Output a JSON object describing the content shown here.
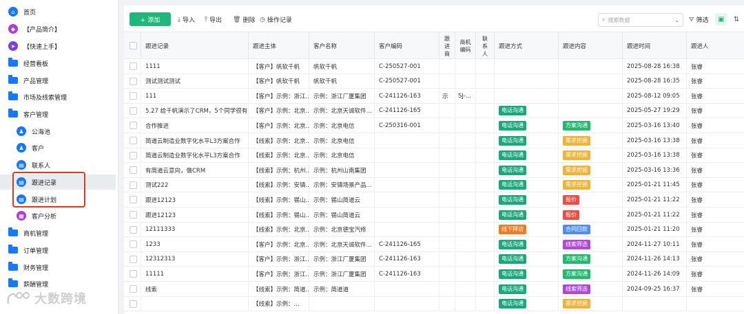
{
  "sidebar": {
    "items": [
      {
        "label": "首页",
        "icon": "home-icon",
        "color": "#1677ff"
      },
      {
        "label": "【产品简介】",
        "icon": "tag-icon",
        "color": "#b03cd6"
      },
      {
        "label": "【快速上手】",
        "icon": "send-icon",
        "color": "#7b3fe4"
      },
      {
        "label": "经营看板",
        "icon": "folder-icon"
      },
      {
        "label": "产品管理",
        "icon": "folder-icon"
      },
      {
        "label": "市场及线索管理",
        "icon": "folder-icon"
      },
      {
        "label": "客户管理",
        "icon": "folder-open-icon"
      },
      {
        "label": "公海池",
        "icon": "users-icon",
        "color": "#1677ff"
      },
      {
        "label": "客户",
        "icon": "user-icon",
        "color": "#1677ff"
      },
      {
        "label": "联系人",
        "icon": "contact-icon",
        "color": "#1677ff"
      },
      {
        "label": "跟进记录",
        "icon": "record-icon",
        "color": "#1677ff"
      },
      {
        "label": "跟进计划",
        "icon": "plan-icon",
        "color": "#1677ff"
      },
      {
        "label": "客户分析",
        "icon": "analysis-icon",
        "color": "#b03cd6"
      },
      {
        "label": "商机管理",
        "icon": "folder-icon"
      },
      {
        "label": "订单管理",
        "icon": "folder-icon"
      },
      {
        "label": "财务管理",
        "icon": "folder-icon"
      },
      {
        "label": "薪酬管理",
        "icon": "folder-icon"
      }
    ]
  },
  "watermark": "大数跨境",
  "toolbar": {
    "add_label": "+ 添加",
    "import_label": "导入",
    "export_label": "导出",
    "delete_label": "删除",
    "log_label": "操作记录",
    "search_placeholder": "搜索数据",
    "filter_label": "筛选"
  },
  "table": {
    "headers": [
      "跟进记录",
      "跟进主体",
      "客户名称",
      "客户编码",
      "跟进商",
      "商机编码",
      "联系人",
      "跟进方式",
      "跟进内容",
      "跟进时间",
      "跟进人"
    ],
    "rows": [
      {
        "record": "1111",
        "subject": "【客户】帆软千帆",
        "customer": "帆软千帆",
        "code": "C-250527-001",
        "biz": "",
        "bizcode": "",
        "contact": "",
        "method": "",
        "content": "",
        "time": "2025-08-28 16:38",
        "owner": "张睿"
      },
      {
        "record": "测试测试测试",
        "subject": "【客户】帆软千帆",
        "customer": "帆软千帆",
        "code": "C-250527-001",
        "biz": "",
        "bizcode": "",
        "contact": "",
        "method": "",
        "content": "",
        "time": "2025-08-28 16:35",
        "owner": "张睿"
      },
      {
        "record": "111",
        "subject": "【客户】示例：浙江...",
        "customer": "示例：浙江厂厦集团",
        "code": "C-241126-163",
        "biz": "示",
        "bizcode": "SJ-...",
        "contact": "",
        "method": "",
        "content": "",
        "time": "2025-08-12 09:05",
        "owner": "张睿"
      },
      {
        "record": "5.27 给千帆演示了CRM，5个同学很有...",
        "subject": "【客户】示例：北京...",
        "customer": "示例：北京天诚软件...",
        "code": "C-241126-165",
        "biz": "",
        "bizcode": "",
        "contact": "",
        "method": "电话沟通",
        "content": "",
        "time": "2025-05-27 19:29",
        "owner": "张睿"
      },
      {
        "record": "合作推进",
        "subject": "【客户】示例：北京...",
        "customer": "示例：北京电信",
        "code": "C-250316-001",
        "biz": "",
        "bizcode": "",
        "contact": "",
        "method": "电话沟通",
        "content": "方案沟通",
        "time": "2025-03-16 13:40",
        "owner": "张睿"
      },
      {
        "record": "简道云制造业数字化水平L3方案合作",
        "subject": "【线索】示例：北京...",
        "customer": "示例：北京电信",
        "code": "",
        "biz": "",
        "bizcode": "",
        "contact": "",
        "method": "电话沟通",
        "content": "需求挖掘",
        "time": "2025-03-16 13:38",
        "owner": "张睿"
      },
      {
        "record": "简道云制造业数字化水平L3方案合作",
        "subject": "【线索】示例：北京...",
        "customer": "示例：北京电信",
        "code": "",
        "biz": "",
        "bizcode": "",
        "contact": "",
        "method": "电话沟通",
        "content": "需求挖掘",
        "time": "2025-03-16 13:38",
        "owner": "张睿"
      },
      {
        "record": "有简道云意向，做CRM",
        "subject": "【线索】示例：杭州...",
        "customer": "示例：杭州山南集团",
        "code": "",
        "biz": "",
        "bizcode": "",
        "contact": "",
        "method": "电话沟通",
        "content": "需求挖掘",
        "time": "2025-03-16 13:36",
        "owner": "张睿"
      },
      {
        "record": "测试222",
        "subject": "【线索】示例：安镇...",
        "customer": "示例：安镇场景产品...",
        "code": "",
        "biz": "",
        "bizcode": "",
        "contact": "",
        "method": "电话沟通",
        "content": "需求挖掘",
        "time": "2025-01-21 11:45",
        "owner": "张睿"
      },
      {
        "record": "跟进12123",
        "subject": "【线索】示例：锡山...",
        "customer": "示例：锡山简道云",
        "code": "",
        "biz": "",
        "bizcode": "",
        "contact": "",
        "method": "电话沟通",
        "content": "报价",
        "time": "2025-01-21 11:22",
        "owner": "张睿"
      },
      {
        "record": "跟进12123",
        "subject": "【线索】示例：锡山...",
        "customer": "示例：锡山简道云",
        "code": "",
        "biz": "",
        "bizcode": "",
        "contact": "",
        "method": "电话沟通",
        "content": "报价",
        "time": "2025-01-21 11:22",
        "owner": "张睿"
      },
      {
        "record": "12111333",
        "subject": "【线索】示例：北京...",
        "customer": "示例：北京德宝汽修",
        "code": "",
        "biz": "",
        "bizcode": "",
        "contact": "",
        "method": "线下拜访",
        "content": "合同回款",
        "time": "2025-01-21 11:20",
        "owner": "张睿"
      },
      {
        "record": "1233",
        "subject": "【客户】示例：北京...",
        "customer": "示例：北京天诚软件...",
        "code": "C-241126-165",
        "biz": "",
        "bizcode": "",
        "contact": "",
        "method": "电话沟通",
        "content": "线索筛选",
        "time": "2024-11-27 10:11",
        "owner": "张睿"
      },
      {
        "record": "12312313",
        "subject": "【客户】示例：浙江...",
        "customer": "示例：浙江厂厦集团",
        "code": "C-241126-163",
        "biz": "",
        "bizcode": "",
        "contact": "",
        "method": "电话沟通",
        "content": "方案沟通",
        "time": "2024-11-26 14:13",
        "owner": "张睿"
      },
      {
        "record": "11111",
        "subject": "【客户】示例：浙江...",
        "customer": "示例：浙江厂厦集团",
        "code": "C-241126-163",
        "biz": "",
        "bizcode": "",
        "contact": "",
        "method": "电话沟通",
        "content": "方案沟通",
        "time": "2024-11-26 14:09",
        "owner": "张睿"
      },
      {
        "record": "线索",
        "subject": "【线索】示例：简道...",
        "customer": "示例：简道道",
        "code": "",
        "biz": "",
        "bizcode": "",
        "contact": "",
        "method": "电话沟通",
        "content": "线索筛选",
        "time": "2024-09-25 16:37",
        "owner": "张睿"
      },
      {
        "record": "",
        "subject": "【线索】示例：...",
        "customer": "",
        "code": "",
        "biz": "",
        "bizcode": "",
        "contact": "",
        "method": "电话沟通",
        "content": "需求挖掘",
        "time": "",
        "owner": ""
      }
    ]
  },
  "tag_colors": {
    "电话沟通": "#1aa87a",
    "线下拜访": "#f07b22",
    "方案沟通": "#22b872",
    "需求挖掘": "#f2b233",
    "报价": "#ee4b43",
    "合同回款": "#4d8cf5",
    "线索筛选": "#b146dd"
  }
}
